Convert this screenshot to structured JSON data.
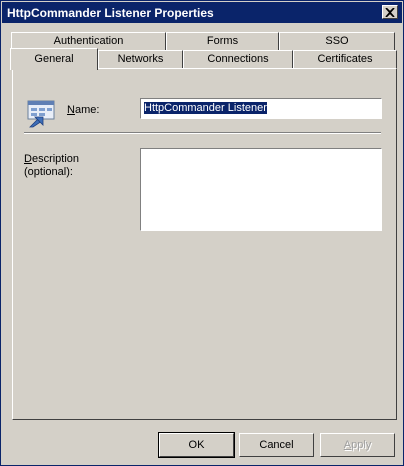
{
  "window": {
    "title": "HttpCommander Listener Properties"
  },
  "tabs": {
    "row1": [
      {
        "label": "Authentication"
      },
      {
        "label": "Forms"
      },
      {
        "label": "SSO"
      }
    ],
    "row2": [
      {
        "label": "General"
      },
      {
        "label": "Networks"
      },
      {
        "label": "Connections"
      },
      {
        "label": "Certificates"
      }
    ],
    "active": "General"
  },
  "general": {
    "icon": "listener-icon",
    "name_label_mnemonic": "N",
    "name_label_rest": "ame:",
    "name_value": "HttpCommander Listener",
    "desc_label_mnemonic": "D",
    "desc_label_rest": "escription",
    "desc_label_line2": "(optional):",
    "desc_value": ""
  },
  "buttons": {
    "ok": "OK",
    "cancel": "Cancel",
    "apply_mnemonic": "A",
    "apply_rest": "pply"
  },
  "colors": {
    "titlebar": "#0a246a",
    "face": "#d4d0c8",
    "selection": "#0a246a"
  }
}
